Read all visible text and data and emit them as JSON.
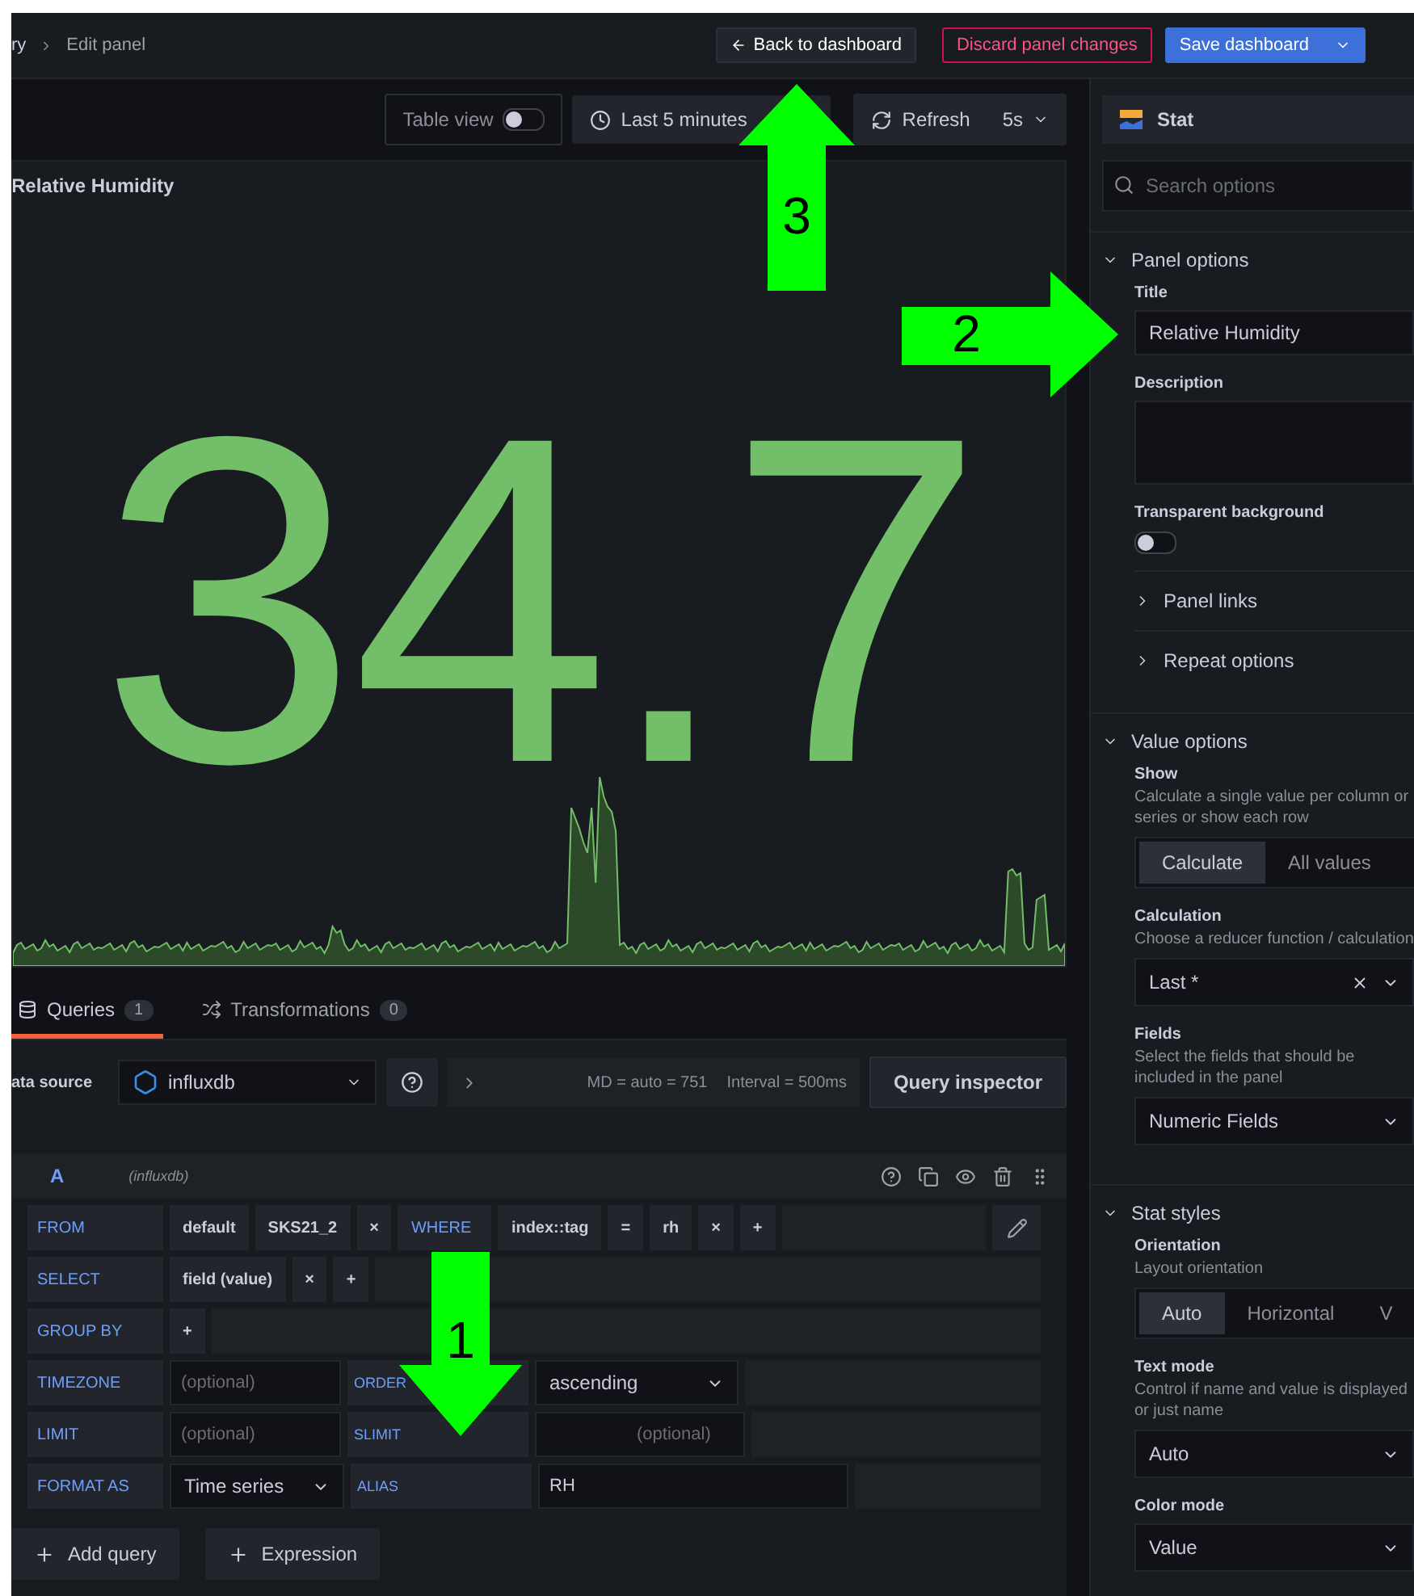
{
  "breadcrumb": {
    "parent": "ry",
    "current": "Edit panel"
  },
  "header_buttons": [
    {
      "kind": "secondary",
      "label": "Back to dashboard"
    },
    {
      "kind": "danger",
      "label": "Discard panel changes"
    },
    {
      "kind": "primary",
      "label": "Save dashboard"
    }
  ],
  "toolbar": {
    "table_view": {
      "label": "Table view",
      "on": false
    },
    "time_range": "Last 5 minutes",
    "refresh": "Refresh",
    "interval": "5s"
  },
  "panel": {
    "title": "Relative Humidity",
    "value": "34.7"
  },
  "tabs": [
    {
      "label": "Queries",
      "count": "1",
      "selected": true
    },
    {
      "label": "Transformations",
      "count": "0",
      "selected": false
    }
  ],
  "datasource": {
    "label": "ata source",
    "name": "influxdb",
    "max_data_points": "MD = auto = 751",
    "interval": "Interval = 500ms",
    "inspector": "Query inspector"
  },
  "query": {
    "ref": "A",
    "source": "(influxdb)",
    "rows": [
      {
        "label": "FROM",
        "parts": [
          {
            "kind": "segment",
            "text": "default"
          },
          {
            "kind": "segment",
            "text": "SKS21_2"
          },
          {
            "kind": "remove",
            "text": "×"
          },
          {
            "kind": "keyword",
            "text": "WHERE"
          },
          {
            "kind": "segment",
            "text": "index::tag"
          },
          {
            "kind": "segment",
            "text": "="
          },
          {
            "kind": "segment",
            "text": "rh"
          },
          {
            "kind": "remove",
            "text": "×"
          },
          {
            "kind": "add",
            "text": "+"
          },
          {
            "kind": "filler"
          },
          {
            "kind": "edit"
          }
        ]
      },
      {
        "label": "SELECT",
        "parts": [
          {
            "kind": "segment",
            "text": "field  (value)"
          },
          {
            "kind": "remove",
            "text": "×"
          },
          {
            "kind": "add",
            "text": "+"
          },
          {
            "kind": "filler"
          }
        ]
      },
      {
        "label": "GROUP BY",
        "parts": [
          {
            "kind": "add",
            "text": "+"
          },
          {
            "kind": "filler"
          }
        ]
      },
      {
        "label": "TIMEZONE",
        "parts": [
          {
            "kind": "input",
            "placeholder": "(optional)"
          },
          {
            "kind": "keyword",
            "text": "ORDER"
          },
          {
            "kind": "select",
            "text": "ascending"
          },
          {
            "kind": "filler"
          }
        ]
      },
      {
        "label": "LIMIT",
        "parts": [
          {
            "kind": "input",
            "placeholder": "(optional)"
          },
          {
            "kind": "keyword",
            "text": "SLIMIT"
          },
          {
            "kind": "input",
            "placeholder": "(optional)"
          },
          {
            "kind": "filler"
          }
        ]
      },
      {
        "label": "FORMAT AS",
        "parts": [
          {
            "kind": "select",
            "text": "Time series"
          },
          {
            "kind": "keyword",
            "text": "ALIAS"
          },
          {
            "kind": "input",
            "value": "RH"
          },
          {
            "kind": "filler"
          }
        ]
      }
    ]
  },
  "add_buttons": [
    "Add query",
    "Expression"
  ],
  "visualization": "Stat",
  "search": {
    "placeholder": "Search options"
  },
  "sections": [
    {
      "title": "Panel options",
      "items": [
        {
          "kind": "text",
          "label": "Title",
          "value": "Relative Humidity"
        },
        {
          "kind": "textarea",
          "label": "Description"
        },
        {
          "kind": "switch",
          "label": "Transparent background",
          "on": false
        },
        {
          "kind": "collapsed",
          "label": "Panel links"
        },
        {
          "kind": "collapsed",
          "label": "Repeat options"
        }
      ]
    },
    {
      "title": "Value options",
      "items": [
        {
          "kind": "radio",
          "label": "Show",
          "description": "Calculate a single value per column or series or show each row",
          "options": [
            {
              "label": "Calculate",
              "selected": true
            },
            {
              "label": "All values",
              "selected": false
            }
          ]
        },
        {
          "kind": "select",
          "label": "Calculation",
          "description": "Choose a reducer function / calculation",
          "value": "Last *",
          "clearable": true
        },
        {
          "kind": "select",
          "label": "Fields",
          "description": "Select the fields that should be included in the panel",
          "value": "Numeric Fields"
        }
      ]
    },
    {
      "title": "Stat styles",
      "items": [
        {
          "kind": "radio",
          "label": "Orientation",
          "description": "Layout orientation",
          "options": [
            {
              "label": "Auto",
              "selected": true
            },
            {
              "label": "Horizontal",
              "selected": false
            },
            {
              "label": "V",
              "selected": false
            }
          ]
        },
        {
          "kind": "select",
          "label": "Text mode",
          "description": "Control if name and value is displayed or just name",
          "value": "Auto"
        },
        {
          "kind": "select",
          "label": "Color mode",
          "value": "Value"
        }
      ]
    }
  ],
  "annotations": [
    {
      "number": "1"
    },
    {
      "number": "2"
    },
    {
      "number": "3"
    }
  ]
}
